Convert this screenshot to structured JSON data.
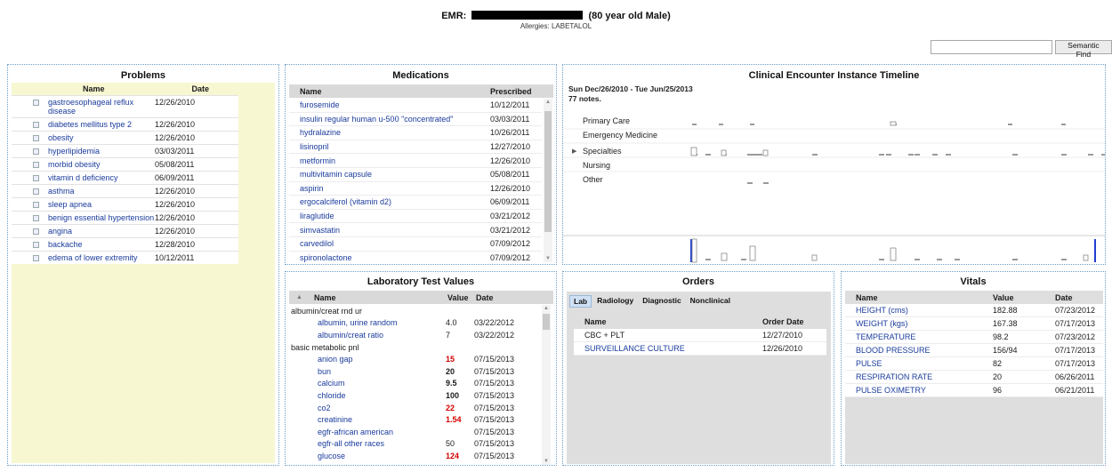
{
  "header": {
    "emr_prefix": "EMR:",
    "patient_desc": "(80 year old Male)",
    "allergies": "Allergies: LABETALOL"
  },
  "semantic_find": {
    "button_label": "Semantic Find",
    "value": ""
  },
  "problems": {
    "title": "Problems",
    "col_name": "Name",
    "col_date": "Date",
    "items": [
      {
        "name": "gastroesophageal reflux disease",
        "date": "12/26/2010"
      },
      {
        "name": "diabetes mellitus type 2",
        "date": "12/26/2010"
      },
      {
        "name": "obesity",
        "date": "12/26/2010"
      },
      {
        "name": "hyperlipidemia",
        "date": "03/03/2011"
      },
      {
        "name": "morbid obesity",
        "date": "05/08/2011"
      },
      {
        "name": "vitamin d deficiency",
        "date": "06/09/2011"
      },
      {
        "name": "asthma",
        "date": "12/26/2010"
      },
      {
        "name": "sleep apnea",
        "date": "12/26/2010"
      },
      {
        "name": "benign essential hypertension",
        "date": "12/26/2010"
      },
      {
        "name": "angina",
        "date": "12/26/2010"
      },
      {
        "name": "backache",
        "date": "12/28/2010"
      },
      {
        "name": "edema of lower extremity",
        "date": "10/12/2011"
      }
    ]
  },
  "medications": {
    "title": "Medications",
    "col_name": "Name",
    "col_prescribed": "Prescribed",
    "items": [
      {
        "name": "furosemide",
        "date": "10/12/2011"
      },
      {
        "name": "insulin regular human u-500 \"concentrated\"",
        "date": "03/03/2011"
      },
      {
        "name": "hydralazine",
        "date": "10/26/2011"
      },
      {
        "name": "lisinopril",
        "date": "12/27/2010"
      },
      {
        "name": "metformin",
        "date": "12/26/2010"
      },
      {
        "name": "multivitamin capsule",
        "date": "05/08/2011"
      },
      {
        "name": "aspirin",
        "date": "12/26/2010"
      },
      {
        "name": "ergocalciferol (vitamin d2)",
        "date": "06/09/2011"
      },
      {
        "name": "liraglutide",
        "date": "03/21/2012"
      },
      {
        "name": "simvastatin",
        "date": "03/21/2012"
      },
      {
        "name": "carvedilol",
        "date": "07/09/2012"
      },
      {
        "name": "spironolactone",
        "date": "07/09/2012"
      }
    ]
  },
  "timeline": {
    "title": "Clinical Encounter Instance Timeline",
    "range": "Sun Dec/26/2010 - Tue Jun/25/2013",
    "notes": "77 notes.",
    "categories": [
      "Primary Care",
      "Emergency Medicine",
      "Specialties",
      "Nursing",
      "Other"
    ],
    "expand_glyph": "▶"
  },
  "labs": {
    "title": "Laboratory Test Values",
    "col_name": "Name",
    "col_value": "Value",
    "col_date": "Date",
    "sort_glyph": "▲",
    "rows": [
      {
        "group": "albumin/creat rnd ur"
      },
      {
        "name": "albumin, urine random",
        "value": "4.0",
        "date": "03/22/2012",
        "flag": ""
      },
      {
        "name": "albumin/creat ratio",
        "value": "7",
        "date": "03/22/2012",
        "flag": ""
      },
      {
        "group": "basic metabolic pnl"
      },
      {
        "name": "anion gap",
        "value": "15",
        "date": "07/15/2013",
        "flag": "hi"
      },
      {
        "name": "bun",
        "value": "20",
        "date": "07/15/2013",
        "flag": "bold"
      },
      {
        "name": "calcium",
        "value": "9.5",
        "date": "07/15/2013",
        "flag": "bold"
      },
      {
        "name": "chloride",
        "value": "100",
        "date": "07/15/2013",
        "flag": "bold"
      },
      {
        "name": "co2",
        "value": "22",
        "date": "07/15/2013",
        "flag": "hi"
      },
      {
        "name": "creatinine",
        "value": "1.54",
        "date": "07/15/2013",
        "flag": "hi"
      },
      {
        "name": "egfr-african american",
        "value": "",
        "date": "07/15/2013",
        "flag": ""
      },
      {
        "name": "egfr-all other races",
        "value": "50",
        "date": "07/15/2013",
        "flag": ""
      },
      {
        "name": "glucose",
        "value": "124",
        "date": "07/15/2013",
        "flag": "hi"
      }
    ]
  },
  "orders": {
    "title": "Orders",
    "tabs": [
      "Lab",
      "Radiology",
      "Diagnostic",
      "Nonclinical"
    ],
    "active_tab": "Lab",
    "col_name": "Name",
    "col_date": "Order Date",
    "items": [
      {
        "name": "CBC + PLT",
        "date": "12/27/2010",
        "link": false
      },
      {
        "name": "SURVEILLANCE CULTURE",
        "date": "12/26/2010",
        "link": true
      }
    ]
  },
  "vitals": {
    "title": "Vitals",
    "col_name": "Name",
    "col_value": "Value",
    "col_date": "Date",
    "items": [
      {
        "name": "HEIGHT (cms)",
        "value": "182.88",
        "date": "07/23/2012"
      },
      {
        "name": "WEIGHT (kgs)",
        "value": "167.38",
        "date": "07/17/2013"
      },
      {
        "name": "TEMPERATURE",
        "value": "98.2",
        "date": "07/23/2012"
      },
      {
        "name": "BLOOD PRESSURE",
        "value": "156/94",
        "date": "07/17/2013"
      },
      {
        "name": "PULSE",
        "value": "82",
        "date": "07/17/2013"
      },
      {
        "name": "RESPIRATION RATE",
        "value": "20",
        "date": "06/26/2011"
      },
      {
        "name": "PULSE OXIMETRY",
        "value": "96",
        "date": "06/21/2011"
      }
    ]
  },
  "colors": {
    "link": "#1a3c9c",
    "high_value": "#d40000",
    "panel_border": "#6e9ec6",
    "problems_bg": "#f7f7d2",
    "timeline_marker": "#1f3fd1"
  }
}
